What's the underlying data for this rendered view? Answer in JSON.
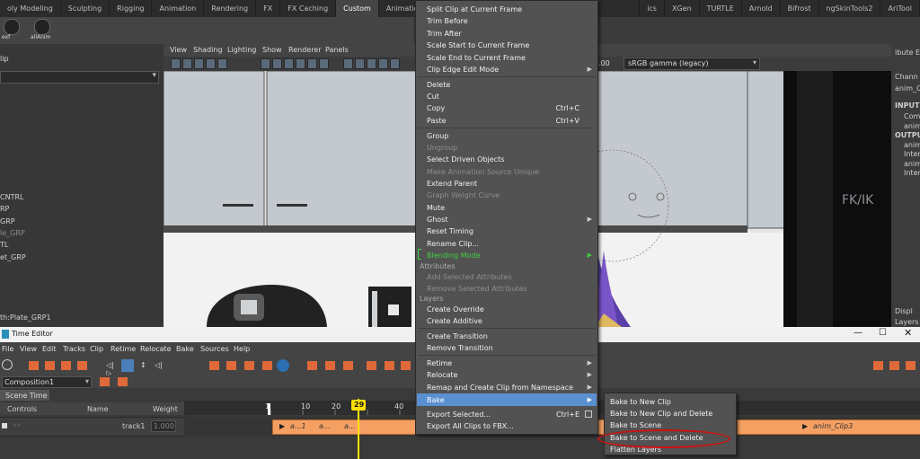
{
  "shelf": {
    "tabs": [
      "oly Modeling",
      "Sculpting",
      "Rigging",
      "Animation",
      "Rendering",
      "FX",
      "FX Caching",
      "Custom",
      "Animation_User",
      "",
      "ics",
      "XGen",
      "TURTLE",
      "Arnold",
      "Bifrost",
      "ngSkinTools2",
      "AriTool"
    ],
    "active_tab": "Custom",
    "icon_labels": [
      "exf",
      "allAnim"
    ]
  },
  "outliner": {
    "header": "lip",
    "items": [
      "CNTRL",
      "RP",
      "GRP",
      "le_GRP",
      "TL",
      "et_GRP"
    ],
    "dim_item": "le_GRP",
    "path": "th:Plate_GRP1"
  },
  "viewport": {
    "menu": [
      "View",
      "Shading",
      "Lighting",
      "Show",
      "Renderer",
      "Panels"
    ],
    "field_value": ".00",
    "colorspace": "sRGB gamma (legacy)",
    "sign_text": "FK/IK"
  },
  "right_panel": {
    "title": "ibute Ed",
    "lines": [
      "Chann",
      "anim_C",
      "INPUTS",
      "Com",
      "anim",
      "OUTPU",
      "anim",
      "Inter",
      "anim",
      "Inter",
      "Displ",
      "Layers"
    ]
  },
  "time_editor": {
    "title": "Time Editor",
    "menu": [
      "File",
      "View",
      "Edit",
      "Tracks",
      "Clip",
      "Retime",
      "Relocate",
      "Bake",
      "Sources",
      "Help"
    ],
    "composition": "Composition1",
    "scene_time_tab": "Scene Time",
    "columns": {
      "controls": "Controls",
      "name": "Name",
      "weight": "Weight"
    },
    "track": {
      "name": "track1",
      "weight": "1.000"
    },
    "ruler_labels": [
      "1",
      "10",
      "20",
      "29",
      "40"
    ],
    "current_frame": "29",
    "clips": [
      "a...1",
      "a...",
      "a...",
      "anim_Clip3"
    ]
  },
  "context_menu": {
    "items": [
      {
        "label": "Split Clip at Current Frame"
      },
      {
        "label": "Trim Before"
      },
      {
        "label": "Trim After"
      },
      {
        "label": "Scale Start to Current Frame"
      },
      {
        "label": "Scale End to Current Frame"
      },
      {
        "label": "Clip Edge Edit Mode",
        "submenu": true
      },
      {
        "label": "Delete"
      },
      {
        "label": "Cut"
      },
      {
        "label": "Copy",
        "shortcut": "Ctrl+C"
      },
      {
        "label": "Paste",
        "shortcut": "Ctrl+V"
      },
      {
        "label": "Group"
      },
      {
        "label": "Ungroup",
        "disabled": true
      },
      {
        "label": "Select Driven Objects"
      },
      {
        "label": "Make Animation Source Unique",
        "disabled": true
      },
      {
        "label": "Extend Parent"
      },
      {
        "label": "Graph Weight Curve",
        "disabled": true
      },
      {
        "label": "Mute"
      },
      {
        "label": "Ghost",
        "submenu": true
      },
      {
        "label": "Reset Timing"
      },
      {
        "label": "Rename Clip..."
      },
      {
        "label": "Blending Mode",
        "submenu": true,
        "highlight": "green"
      },
      {
        "label": "Add Selected Attributes",
        "disabled": true
      },
      {
        "label": "Remove Selected Attributes",
        "disabled": true
      },
      {
        "label": "Create Override"
      },
      {
        "label": "Create Additive"
      },
      {
        "label": "Create Transition"
      },
      {
        "label": "Remove Transition"
      },
      {
        "label": "Retime",
        "submenu": true
      },
      {
        "label": "Relocate",
        "submenu": true
      },
      {
        "label": "Remap and Create Clip from Namespace",
        "submenu": true
      },
      {
        "label": "Bake",
        "submenu": true,
        "active": true
      },
      {
        "label": "Export Selected...",
        "shortcut": "Ctrl+E"
      },
      {
        "label": "Export All Clips to FBX..."
      }
    ],
    "sections": [
      "Attributes",
      "Layers"
    ]
  },
  "bake_submenu": {
    "items": [
      "Bake to New Clip",
      "Bake to New Clip and Delete",
      "Bake to Scene",
      "Bake to Scene and Delete",
      "Flatten Layers"
    ],
    "circled": "Bake to Scene and Delete"
  },
  "colors": {
    "menu_bg": "#525252",
    "highlight": "#5a8fd0",
    "green_text": "#3fd33f",
    "clip_orange": "#f4a063",
    "timeline_marker": "#ffe100",
    "annotation_red": "#d01010"
  }
}
